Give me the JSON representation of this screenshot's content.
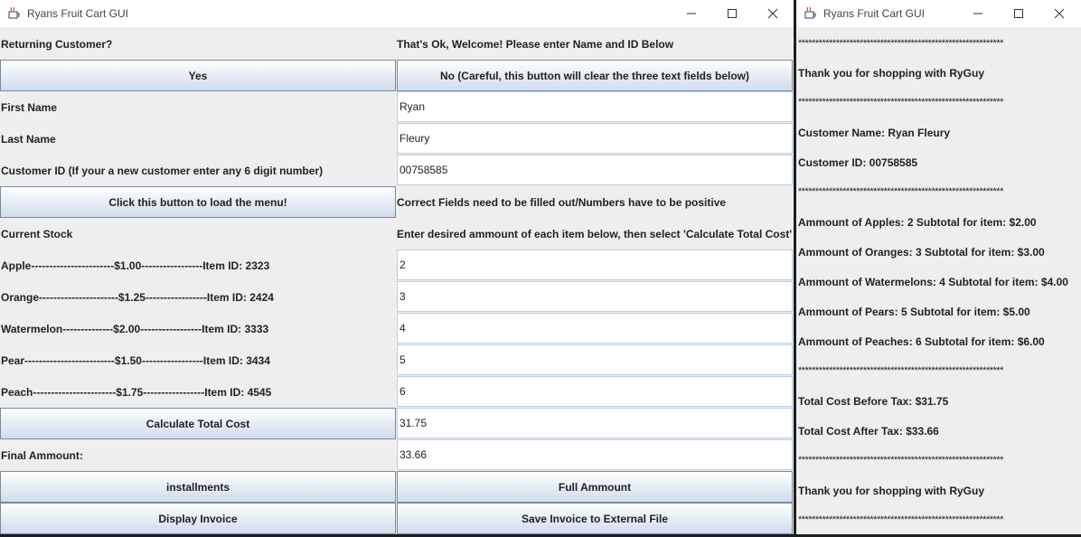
{
  "main_window": {
    "title": "Ryans Fruit Cart GUI",
    "labels": {
      "returning": "Returning Customer?",
      "welcome": "That's Ok, Welcome! Please enter Name and ID Below",
      "first_name": "First Name",
      "last_name": "Last Name",
      "customer_id": "Customer ID (If your a new customer enter any 6 digit number)",
      "validation": "Correct Fields need to be filled out/Numbers have to be positive",
      "current_stock": "Current Stock",
      "instructions": "Enter desired ammount of each item below, then select 'Calculate Total Cost'",
      "final_amount": "Final Ammount:"
    },
    "buttons": {
      "yes": "Yes",
      "no": "No (Careful, this button will clear the three text fields below)",
      "load_menu": "Click this button to load the menu!",
      "calculate": "Calculate Total Cost",
      "installments": "installments",
      "full_amount": "Full Ammount",
      "display_invoice": "Display Invoice",
      "save_invoice": "Save Invoice to External File"
    },
    "fields": {
      "first_name": "Ryan",
      "last_name": "Fleury",
      "customer_id": "00758585",
      "total_cost": "31.75",
      "final_amount": "33.66"
    },
    "stock": [
      {
        "label": "Apple-----------------------$1.00-----------------Item ID: 2323",
        "qty": "2"
      },
      {
        "label": "Orange----------------------$1.25-----------------Item ID: 2424",
        "qty": "3"
      },
      {
        "label": "Watermelon--------------$2.00-----------------Item ID: 3333",
        "qty": "4"
      },
      {
        "label": "Pear-------------------------$1.50-----------------Item ID: 3434",
        "qty": "5"
      },
      {
        "label": "Peach-----------------------$1.75-----------------Item ID: 4545",
        "qty": "6"
      }
    ]
  },
  "invoice_window": {
    "title": "Ryans Fruit Cart GUI",
    "separator": "************************************************************",
    "thanks": "Thank you for shopping with RyGuy",
    "customer_name": "Customer Name: Ryan Fleury",
    "customer_id": "Customer ID: 00758585",
    "items": [
      "Ammount of Apples: 2   Subtotal for item:  $2.00",
      "Ammount of Oranges: 3   Subtotal for item:  $3.00",
      "Ammount of Watermelons: 4   Subtotal for item:  $4.00",
      "Ammount of Pears: 5   Subtotal for item:  $5.00",
      "Ammount of Peaches: 6   Subtotal for item:  $6.00"
    ],
    "total_before_tax": "Total Cost Before Tax:  $31.75",
    "total_after_tax": "Total Cost After Tax:  $33.66"
  }
}
